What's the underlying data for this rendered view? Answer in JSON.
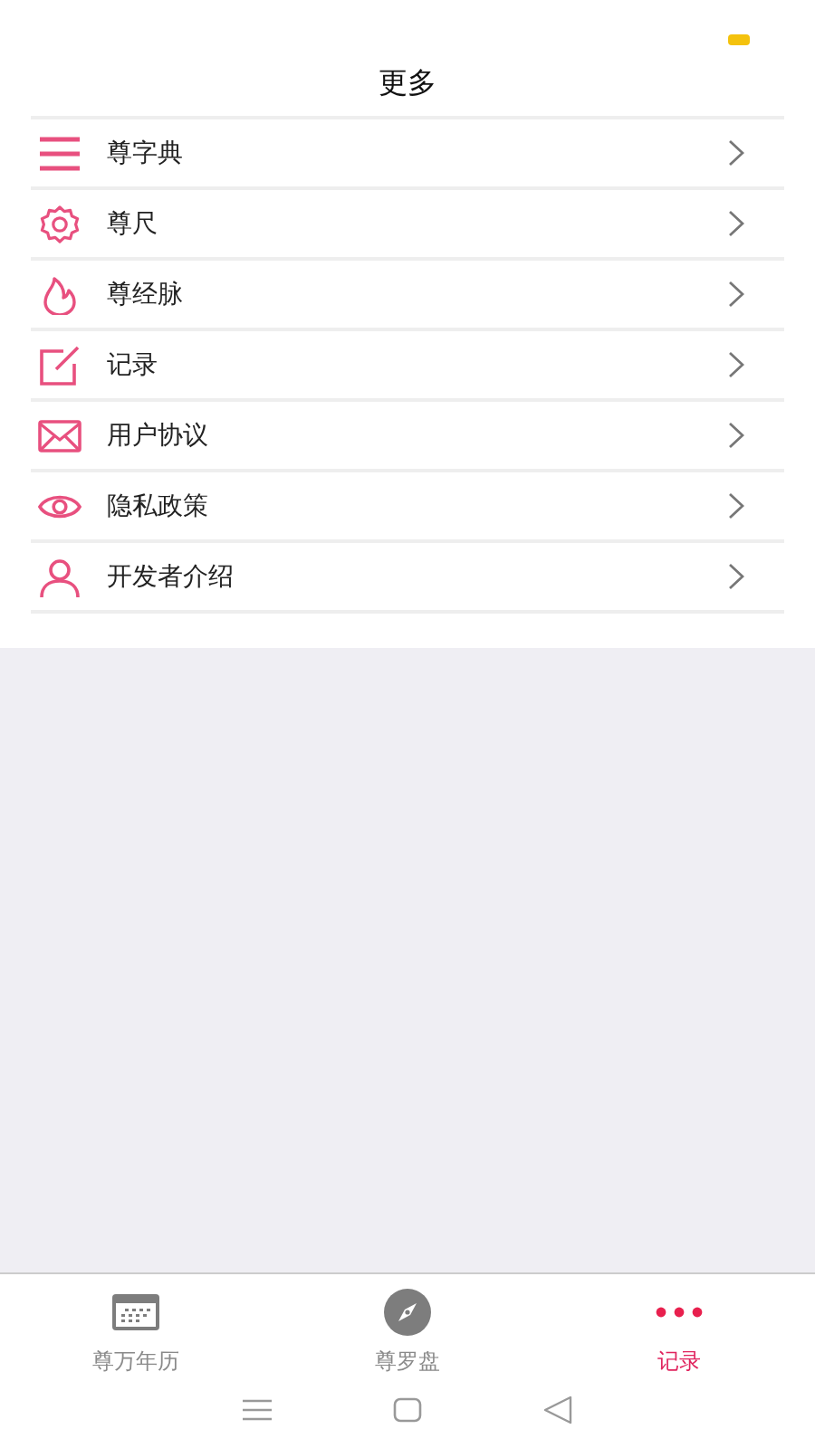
{
  "header": {
    "title": "更多"
  },
  "menu": [
    {
      "label": "尊字典"
    },
    {
      "label": "尊尺"
    },
    {
      "label": "尊经脉"
    },
    {
      "label": "记录"
    },
    {
      "label": "用户协议"
    },
    {
      "label": "隐私政策"
    },
    {
      "label": "开发者介绍"
    }
  ],
  "tabs": [
    {
      "label": "尊万年历",
      "selected": false
    },
    {
      "label": "尊罗盘",
      "selected": false
    },
    {
      "label": "记录",
      "selected": true
    }
  ]
}
